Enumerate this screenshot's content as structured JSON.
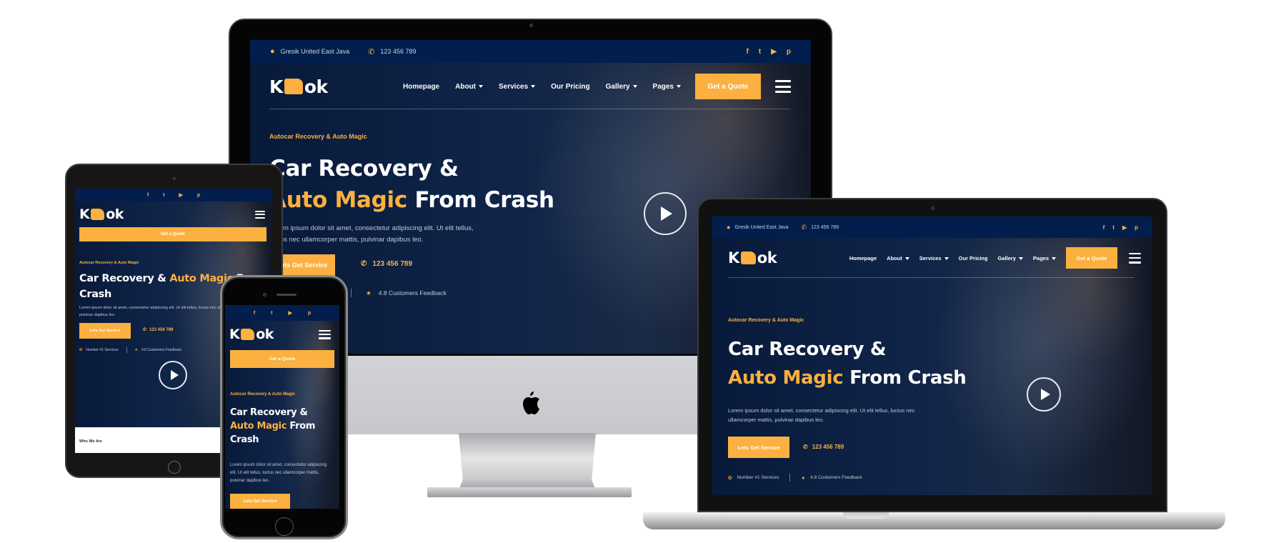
{
  "site": {
    "logo_left": "K",
    "logo_right": "ok",
    "accent_color": "#fbb040",
    "navy_color": "#021e4c"
  },
  "topbar": {
    "location_icon": "map-pin-icon",
    "location": "Gresik United East Java",
    "phone_icon": "phone-icon",
    "phone": "123 456 789",
    "socials": [
      {
        "name": "facebook-icon",
        "glyph": "f"
      },
      {
        "name": "twitter-icon",
        "glyph": "t"
      },
      {
        "name": "youtube-icon",
        "glyph": "▶"
      },
      {
        "name": "pinterest-icon",
        "glyph": "p"
      }
    ]
  },
  "nav": {
    "items": [
      {
        "label": "Homepage",
        "dropdown": false
      },
      {
        "label": "About",
        "dropdown": true
      },
      {
        "label": "Services",
        "dropdown": true
      },
      {
        "label": "Our Pricing",
        "dropdown": false
      },
      {
        "label": "Gallery",
        "dropdown": true
      },
      {
        "label": "Pages",
        "dropdown": true
      }
    ],
    "cta": "Get a Quote",
    "menu_icon": "hamburger-icon"
  },
  "hero": {
    "tagline": "Autocar Recovery & Auto Magic",
    "title_line1": "Car Recovery &",
    "title_highlight": "Auto Magic",
    "title_rest": "From Crash",
    "title_crash": "Crash",
    "title_from": "From",
    "description": "Lorem ipsum dolor sit amet, consectetur adipiscing elit. Ut elit tellus, luctus nec ullamcorper mattis, pulvinar dapibus leo.",
    "cta": "Lets Get Service",
    "phone": "123 456 789",
    "badge1": "Number #1 Services",
    "badge2": "4.8 Customers Feedback",
    "play_icon": "play-icon"
  },
  "sections": {
    "who_we_are": "Who We Are"
  }
}
